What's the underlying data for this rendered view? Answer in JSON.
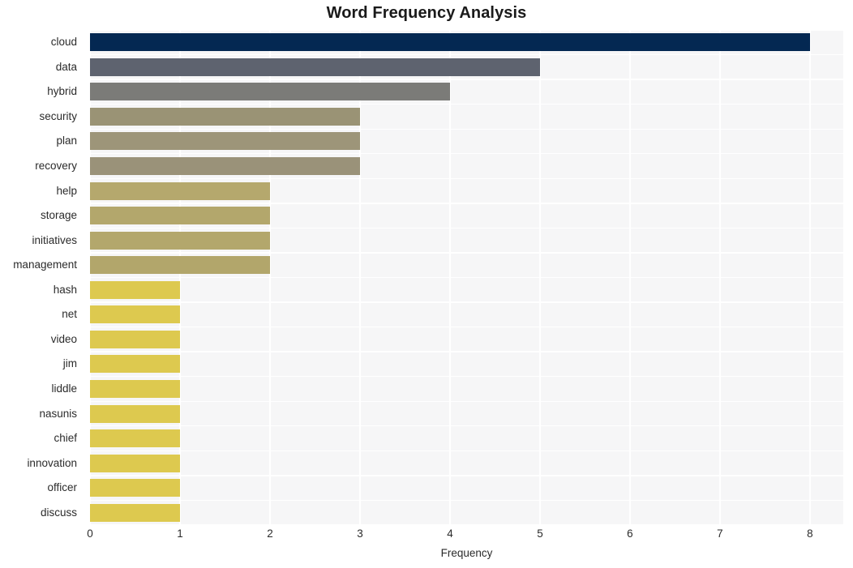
{
  "chart_data": {
    "type": "bar",
    "orientation": "horizontal",
    "title": "Word Frequency Analysis",
    "xlabel": "Frequency",
    "ylabel": "",
    "categories": [
      "cloud",
      "data",
      "hybrid",
      "security",
      "plan",
      "recovery",
      "help",
      "storage",
      "initiatives",
      "management",
      "hash",
      "net",
      "video",
      "jim",
      "liddle",
      "nasunis",
      "chief",
      "innovation",
      "officer",
      "discuss"
    ],
    "values": [
      8,
      5,
      4,
      3,
      3,
      3,
      2,
      2,
      2,
      2,
      1,
      1,
      1,
      1,
      1,
      1,
      1,
      1,
      1,
      1
    ],
    "bar_colors": [
      "#042852",
      "#5e636f",
      "#7b7b78",
      "#9a9375",
      "#9d9579",
      "#9a9279",
      "#b5a86d",
      "#b3a76c",
      "#b3a76c",
      "#b2a66b",
      "#ddc94f",
      "#ddc94f",
      "#ddc94f",
      "#ddc94f",
      "#ddc94f",
      "#ddc94f",
      "#ddc94f",
      "#ddc94f",
      "#ddc94f",
      "#ddc94f"
    ],
    "xticks": [
      0,
      1,
      2,
      3,
      4,
      5,
      6,
      7,
      8
    ],
    "xtick_labels": [
      "0",
      "1",
      "2",
      "3",
      "4",
      "5",
      "6",
      "7",
      "8"
    ],
    "xlim": [
      0,
      8.37
    ],
    "grid": true,
    "legend": false,
    "plot_background": "#f6f6f7",
    "gridline_color": "#ffffff",
    "title_color": "#1a1a1a",
    "tick_label_color": "#2b2b2b"
  }
}
